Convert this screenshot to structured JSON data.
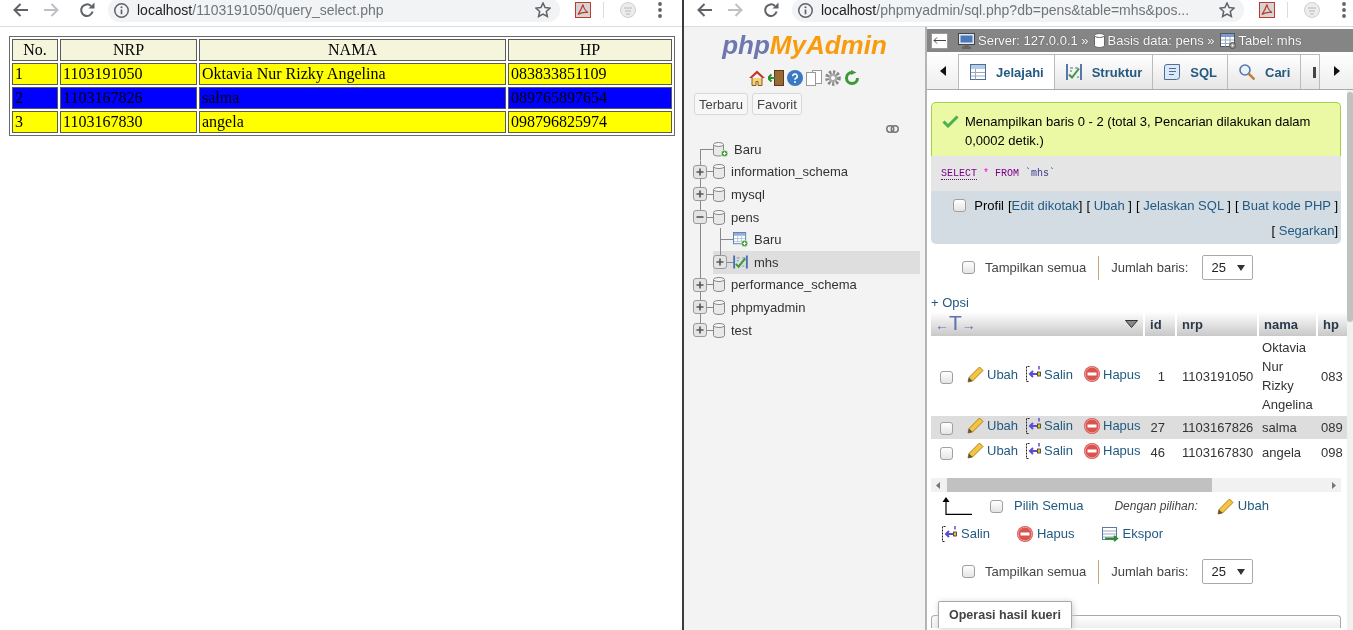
{
  "left_window": {
    "address_bar": {
      "host": "localhost",
      "path": "/1103191050/query_select.php"
    },
    "table": {
      "columns": [
        "No.",
        "NRP",
        "NAMA",
        "HP"
      ],
      "rows": [
        {
          "color": "#ffff00",
          "cells": [
            "1",
            "1103191050",
            "Oktavia Nur Rizky Angelina",
            "083833851109"
          ]
        },
        {
          "color": "#0000ff",
          "cells": [
            "2",
            "1103167826",
            "salma",
            "089765897654"
          ]
        },
        {
          "color": "#ffff00",
          "cells": [
            "3",
            "1103167830",
            "angela",
            "098796825974"
          ]
        }
      ]
    }
  },
  "right_window": {
    "address_bar": {
      "host": "localhost",
      "path": "/phpmyadmin/sql.php?db=pens&table=mhs&pos..."
    },
    "navigation": {
      "logo": {
        "first": "php",
        "second": "MyAdmin"
      },
      "buttons": [
        "Terbaru",
        "Favorit"
      ],
      "tree": [
        {
          "kind": "new_database",
          "label": "Baru",
          "selected": false
        },
        {
          "kind": "database",
          "label": "information_schema",
          "expanded": false,
          "selected": false
        },
        {
          "kind": "database",
          "label": "mysql",
          "expanded": false,
          "selected": false
        },
        {
          "kind": "database",
          "label": "pens",
          "expanded": true,
          "selected": false,
          "children": [
            {
              "kind": "new_table",
              "label": "Baru",
              "selected": false
            },
            {
              "kind": "table",
              "label": "mhs",
              "expanded": false,
              "selected": true
            }
          ]
        },
        {
          "kind": "database",
          "label": "performance_schema",
          "expanded": false,
          "selected": false
        },
        {
          "kind": "database",
          "label": "phpmyadmin",
          "expanded": false,
          "selected": false
        },
        {
          "kind": "database",
          "label": "test",
          "expanded": false,
          "selected": false
        }
      ]
    },
    "main": {
      "breadcrumb": [
        {
          "kind": "server",
          "text": "Server: 127.0.0.1 »"
        },
        {
          "kind": "database",
          "text": "Basis data: pens »"
        },
        {
          "kind": "table",
          "text": "Tabel: mhs"
        }
      ],
      "tabs": [
        {
          "kind": "browse",
          "label": "Jelajahi",
          "selected": true
        },
        {
          "kind": "structure",
          "label": "Struktur",
          "selected": false
        },
        {
          "kind": "sql",
          "label": "SQL",
          "selected": false
        },
        {
          "kind": "search",
          "label": "Cari",
          "selected": false
        }
      ],
      "message": {
        "kind": "success",
        "text": "Menampilkan baris 0 - 2 (total 3, Pencarian dilakukan dalam 0,0002 detik.)"
      },
      "sql": [
        {
          "kind": "keyword_link",
          "text": "SELECT"
        },
        {
          "kind": "operator",
          "text": "*"
        },
        {
          "kind": "keyword",
          "text": "FROM"
        },
        {
          "kind": "identifier",
          "text": "`mhs`"
        }
      ],
      "profiling": {
        "label": "Profil",
        "checked": false,
        "links": [
          {
            "before": "[",
            "text": "Edit dikotak",
            "after": "]"
          },
          {
            "before": "[ ",
            "text": "Ubah",
            "after": " ]"
          },
          {
            "before": "[ ",
            "text": "Jelaskan SQL",
            "after": " ]"
          },
          {
            "before": "[ ",
            "text": "Buat kode PHP",
            "after": " ]"
          },
          {
            "before": "[ ",
            "text": "Segarkan",
            "after": "]"
          }
        ]
      },
      "top_controls": {
        "show_all": {
          "label": "Tampilkan semua",
          "checked": false
        },
        "rows_label": "Jumlah baris:",
        "rows_value": "25"
      },
      "options_link": "+ Opsi",
      "results": {
        "toggle": {
          "left": "←",
          "link": "T",
          "right": "→"
        },
        "columns": [
          "id",
          "nrp",
          "nama",
          "hp"
        ],
        "rows": [
          {
            "checked": false,
            "highlighted": false,
            "actions": [
              {
                "kind": "edit",
                "label": "Ubah"
              },
              {
                "kind": "copy",
                "label": "Salin"
              },
              {
                "kind": "delete",
                "label": "Hapus"
              }
            ],
            "cells": [
              "1",
              "1103191050",
              "Oktavia Nur Rizky Angelina",
              "083"
            ]
          },
          {
            "checked": false,
            "highlighted": true,
            "actions": [
              {
                "kind": "edit",
                "label": "Ubah"
              },
              {
                "kind": "copy",
                "label": "Salin"
              },
              {
                "kind": "delete",
                "label": "Hapus"
              }
            ],
            "cells": [
              "27",
              "1103167826",
              "salma",
              "089"
            ]
          },
          {
            "checked": false,
            "highlighted": false,
            "actions": [
              {
                "kind": "edit",
                "label": "Ubah"
              },
              {
                "kind": "copy",
                "label": "Salin"
              },
              {
                "kind": "delete",
                "label": "Hapus"
              }
            ],
            "cells": [
              "46",
              "1103167830",
              "angela",
              "098"
            ]
          }
        ]
      },
      "bulk": {
        "select_all": {
          "label": "Pilih Semua",
          "checked": false
        },
        "with_selected": "Dengan pilihan:",
        "actions": [
          {
            "kind": "edit",
            "label": "Ubah"
          },
          {
            "kind": "copy",
            "label": "Salin"
          },
          {
            "kind": "delete",
            "label": "Hapus"
          },
          {
            "kind": "export",
            "label": "Ekspor"
          }
        ]
      },
      "bottom_controls": {
        "show_all": {
          "label": "Tampilkan semua",
          "checked": false
        },
        "rows_label": "Jumlah baris:",
        "rows_value": "25"
      },
      "result_operations": "Operasi hasil kueri"
    }
  }
}
